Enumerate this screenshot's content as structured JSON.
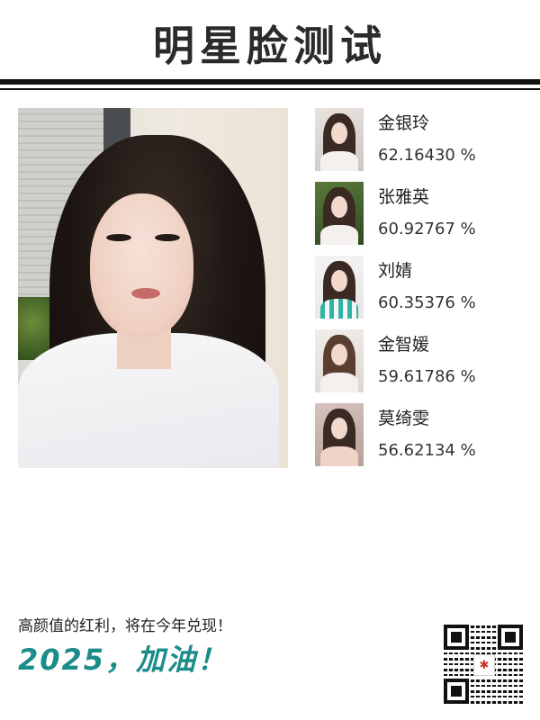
{
  "header": {
    "title": "明星脸测试"
  },
  "photo": {
    "icon": "user-selfie-photo"
  },
  "matches": [
    {
      "name": "金银玲",
      "score": "62.16430 %"
    },
    {
      "name": "张雅英",
      "score": "60.92767 %"
    },
    {
      "name": "刘婧",
      "score": "60.35376 %"
    },
    {
      "name": "金智媛",
      "score": "59.61786 %"
    },
    {
      "name": "莫绮雯",
      "score": "56.62134 %"
    }
  ],
  "footer": {
    "tagline": "高颜值的红利，将在今年兑现！",
    "slogan": "2025，加油！",
    "slogan_color": "#1b8c89"
  }
}
